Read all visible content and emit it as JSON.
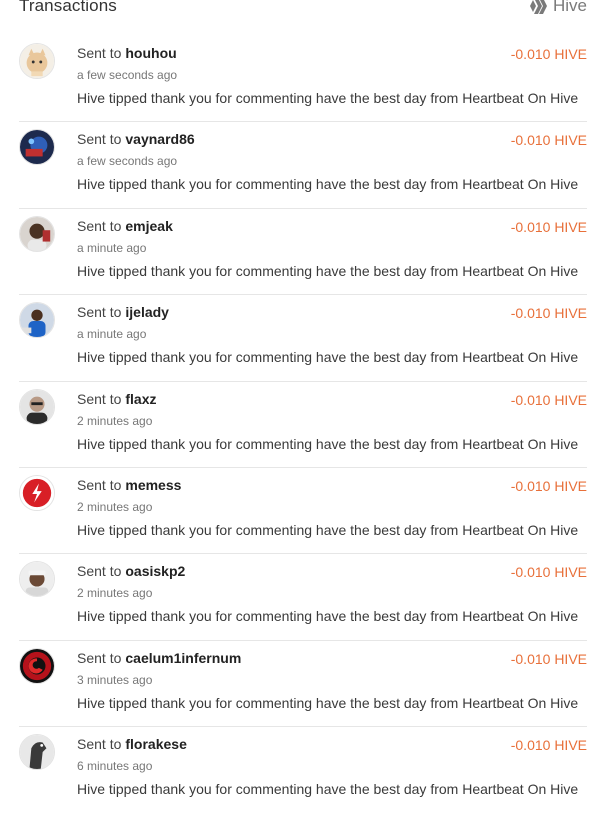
{
  "header": {
    "title": "Transactions",
    "brand": "Hive",
    "brand_icon": "hive-logo-icon"
  },
  "colors": {
    "amount": "#e8703a",
    "divider": "#e6e6e6"
  },
  "transactions": [
    {
      "prefix": "Sent to",
      "user": "houhou",
      "time": "a few seconds ago",
      "amount": "-0.010 HIVE",
      "memo": "Hive tipped thank you for commenting have the best day from Heartbeat On Hive",
      "avatar": "cat-avatar"
    },
    {
      "prefix": "Sent to",
      "user": "vaynard86",
      "time": "a few seconds ago",
      "amount": "-0.010 HIVE",
      "memo": "Hive tipped thank you for commenting have the best day from Heartbeat On Hive",
      "avatar": "robot-avatar"
    },
    {
      "prefix": "Sent to",
      "user": "emjeak",
      "time": "a minute ago",
      "amount": "-0.010 HIVE",
      "memo": "Hive tipped thank you for commenting have the best day from Heartbeat On Hive",
      "avatar": "person-avatar"
    },
    {
      "prefix": "Sent to",
      "user": "ijelady",
      "time": "a minute ago",
      "amount": "-0.010 HIVE",
      "memo": "Hive tipped thank you for commenting have the best day from Heartbeat On Hive",
      "avatar": "person-avatar"
    },
    {
      "prefix": "Sent to",
      "user": "flaxz",
      "time": "2 minutes ago",
      "amount": "-0.010 HIVE",
      "memo": "Hive tipped thank you for commenting have the best day from Heartbeat On Hive",
      "avatar": "person-avatar"
    },
    {
      "prefix": "Sent to",
      "user": "memess",
      "time": "2 minutes ago",
      "amount": "-0.010 HIVE",
      "memo": "Hive tipped thank you for commenting have the best day from Heartbeat On Hive",
      "avatar": "logo-avatar"
    },
    {
      "prefix": "Sent to",
      "user": "oasiskp2",
      "time": "2 minutes ago",
      "amount": "-0.010 HIVE",
      "memo": "Hive tipped thank you for commenting have the best day from Heartbeat On Hive",
      "avatar": "person-avatar"
    },
    {
      "prefix": "Sent to",
      "user": "caelum1infernum",
      "time": "3 minutes ago",
      "amount": "-0.010 HIVE",
      "memo": "Hive tipped thank you for commenting have the best day from Heartbeat On Hive",
      "avatar": "logo-avatar"
    },
    {
      "prefix": "Sent to",
      "user": "florakese",
      "time": "6 minutes ago",
      "amount": "-0.010 HIVE",
      "memo": "Hive tipped thank you for commenting have the best day from Heartbeat On Hive",
      "avatar": "horse-avatar"
    }
  ]
}
